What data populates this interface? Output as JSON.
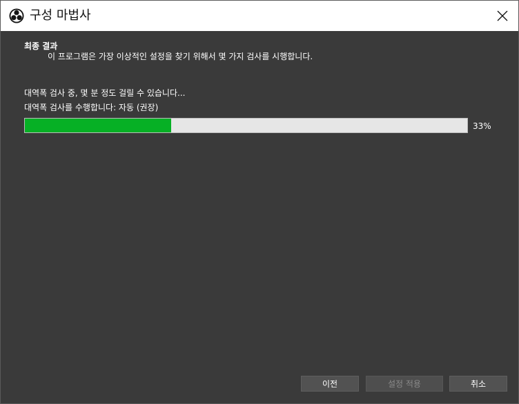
{
  "window": {
    "title": "구성 마법사",
    "app_icon": "obs-logo-icon",
    "close_icon": "close-icon"
  },
  "header": {
    "title": "최종 결과",
    "subtitle": "이 프로그램은 가장 이상적인 설정을 찾기 위해서 몇 가지 검사를 시행합니다."
  },
  "status": {
    "line1": "대역폭 검사 중, 몇 분 정도 걸릴 수 있습니다...",
    "line2": "대역폭 검사를 수행합니다: 자동 (권장)"
  },
  "progress": {
    "value": 33,
    "label": "33%",
    "fill_color": "#06b025"
  },
  "buttons": {
    "back": "이전",
    "apply": "설정 적용",
    "cancel": "취소"
  }
}
